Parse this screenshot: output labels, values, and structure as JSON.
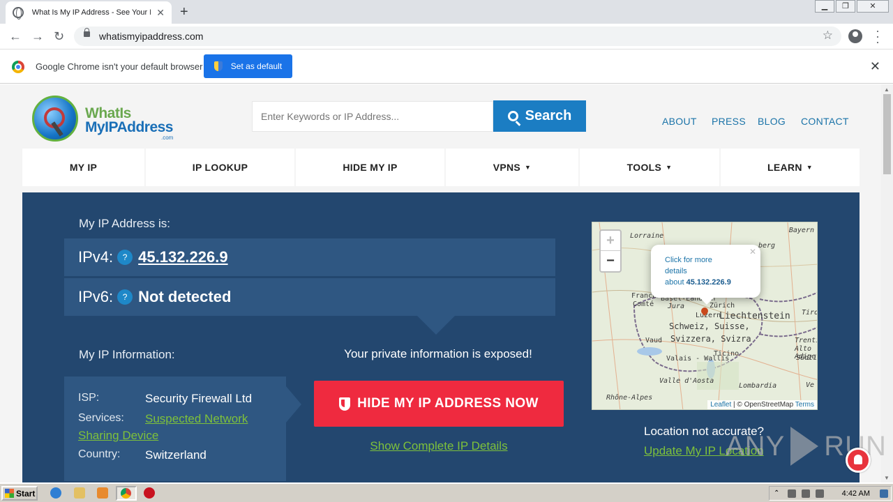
{
  "browser": {
    "tab_title": "What Is My IP Address - See Your Pu",
    "url": "whatismyipaddress.com"
  },
  "infobar": {
    "message": "Google Chrome isn't your default browser",
    "button": "Set as default"
  },
  "site": {
    "logo": {
      "line1": "WhatIs",
      "line2": "MyIPAddress",
      "suffix": ".com"
    },
    "search": {
      "placeholder": "Enter Keywords or IP Address...",
      "button": "Search"
    },
    "top_links": [
      "ABOUT",
      "PRESS",
      "BLOG",
      "CONTACT"
    ],
    "nav": [
      {
        "label": "MY IP",
        "dropdown": false
      },
      {
        "label": "IP LOOKUP",
        "dropdown": false
      },
      {
        "label": "HIDE MY IP",
        "dropdown": false
      },
      {
        "label": "VPNS",
        "dropdown": true
      },
      {
        "label": "TOOLS",
        "dropdown": true
      },
      {
        "label": "LEARN",
        "dropdown": true
      }
    ]
  },
  "ip": {
    "heading": "My IP Address is:",
    "ipv4_label": "IPv4:",
    "ipv4": "45.132.226.9",
    "ipv6_label": "IPv6:",
    "ipv6": "Not detected",
    "help": "?"
  },
  "info": {
    "heading": "My IP Information:",
    "isp_label": "ISP:",
    "isp": "Security Firewall Ltd",
    "services_label": "Services:",
    "services_1": "Suspected Network",
    "services_2": "Sharing Device",
    "country_label": "Country:",
    "country": "Switzerland"
  },
  "cta": {
    "exposed": "Your private information is exposed!",
    "hide_button": "HIDE MY IP ADDRESS NOW",
    "details_link": "Show Complete IP Details"
  },
  "map": {
    "zoom_in": "+",
    "zoom_out": "−",
    "popup_line1": "Click for more",
    "popup_line2": "details",
    "popup_about": "about",
    "popup_ip": "45.132.226.9",
    "labels": {
      "bayern": "Bayern",
      "lorraine": "Lorraine",
      "burg": "berg",
      "franche": "Franche-",
      "comte": "Comté",
      "basel": "Basel-Landsch",
      "zurich": "Zürich",
      "jura": "Jura",
      "luzern": "Luzern",
      "liechtenstein": "Liechtenstein",
      "schweiz": "Schweiz, Suisse,",
      "svizzera": "Svizzera, Svizra",
      "vaud": "Vaud",
      "tirol": "Tirol",
      "trentino": "Trentino-",
      "alto_adige": "Alto Adige",
      "sudtirol": "Südtirol",
      "valais": "Valais - Wallis",
      "ticino": "Ticino",
      "aosta": "Valle d'Aosta",
      "lombardia": "Lombardia",
      "rhone": "Rhône-Alpes",
      "ve": "Ve"
    },
    "attribution_leaflet": "Leaflet",
    "attribution_sep": " | © OpenStreetMap ",
    "attribution_terms": "Terms"
  },
  "location": {
    "not_accurate": "Location not accurate?",
    "update_link": "Update My IP Location"
  },
  "watermark": {
    "left": "ANY",
    "right": "RUN"
  },
  "taskbar": {
    "start": "Start",
    "clock": "4:42 AM"
  }
}
